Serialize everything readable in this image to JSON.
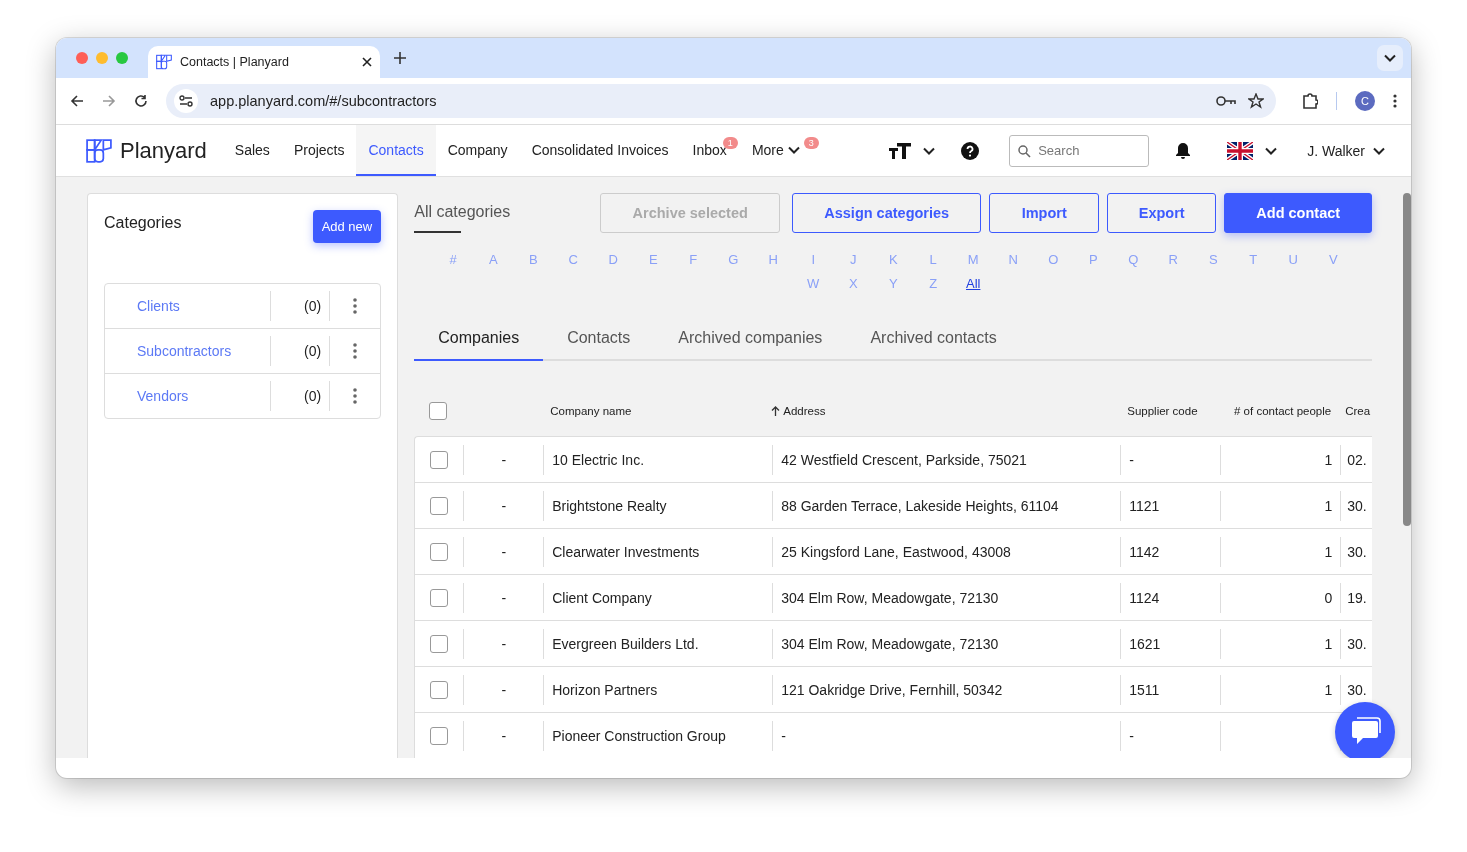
{
  "browser": {
    "tab_title": "Contacts | Planyard",
    "url": "app.planyard.com/#/subcontractors",
    "profile_initial": "C"
  },
  "app": {
    "logo": "Planyard",
    "nav": [
      {
        "label": "Sales",
        "selected": false
      },
      {
        "label": "Projects",
        "selected": false
      },
      {
        "label": "Contacts",
        "selected": true
      },
      {
        "label": "Company",
        "selected": false
      },
      {
        "label": "Consolidated Invoices",
        "selected": false
      },
      {
        "label": "Inbox",
        "selected": false,
        "badge": "1"
      },
      {
        "label": "More",
        "selected": false,
        "badge": "3",
        "kind": "menu"
      }
    ],
    "search": {
      "placeholder": "Search"
    },
    "user": "J. Walker"
  },
  "categories": {
    "title": "Categories",
    "add_button": "Add new",
    "items": [
      {
        "name": "Clients",
        "count": "(0)"
      },
      {
        "name": "Subcontractors",
        "count": "(0)"
      },
      {
        "name": "Vendors",
        "count": "(0)"
      }
    ]
  },
  "filter_label": "All categories",
  "actions": [
    {
      "label": "Archive selected",
      "kind": "disabled"
    },
    {
      "label": "Assign categories",
      "kind": "outline"
    },
    {
      "label": "Import",
      "kind": "outline"
    },
    {
      "label": "Export",
      "kind": "outline"
    },
    {
      "label": "Add contact",
      "kind": "primary"
    }
  ],
  "letters": [
    {
      "label": "#",
      "selected": false
    },
    {
      "label": "A",
      "selected": false
    },
    {
      "label": "B",
      "selected": false
    },
    {
      "label": "C",
      "selected": false
    },
    {
      "label": "D",
      "selected": false
    },
    {
      "label": "E",
      "selected": false
    },
    {
      "label": "F",
      "selected": false
    },
    {
      "label": "G",
      "selected": false
    },
    {
      "label": "H",
      "selected": false
    },
    {
      "label": "I",
      "selected": false
    },
    {
      "label": "J",
      "selected": false
    },
    {
      "label": "K",
      "selected": false
    },
    {
      "label": "L",
      "selected": false
    },
    {
      "label": "M",
      "selected": false
    },
    {
      "label": "N",
      "selected": false
    },
    {
      "label": "O",
      "selected": false
    },
    {
      "label": "P",
      "selected": false
    },
    {
      "label": "Q",
      "selected": false
    },
    {
      "label": "R",
      "selected": false
    },
    {
      "label": "S",
      "selected": false
    },
    {
      "label": "T",
      "selected": false
    },
    {
      "label": "U",
      "selected": false
    },
    {
      "label": "V",
      "selected": false
    },
    {
      "label": "W",
      "selected": false
    },
    {
      "label": "X",
      "selected": false
    },
    {
      "label": "Y",
      "selected": false
    },
    {
      "label": "Z",
      "selected": false
    },
    {
      "label": "All",
      "selected": true
    }
  ],
  "tabs": [
    {
      "label": "Companies",
      "selected": true
    },
    {
      "label": "Contacts",
      "selected": false
    },
    {
      "label": "Archived companies",
      "selected": false
    },
    {
      "label": "Archived contacts",
      "selected": false
    }
  ],
  "table": {
    "header_checked": false,
    "columns": [
      {
        "label": "Company name",
        "sorted": false
      },
      {
        "label": "Address",
        "sorted": true
      },
      {
        "label": "Supplier code",
        "sorted": false
      },
      {
        "label": "# of contact people",
        "sorted": false
      },
      {
        "label": "Crea",
        "sorted": false
      }
    ],
    "rows": [
      {
        "checked": false,
        "category": "-",
        "name": "10 Electric Inc.",
        "address": "42 Westfield Crescent, Parkside, 75021",
        "supplier_code": "-",
        "contacts": "1",
        "created": "02."
      },
      {
        "checked": false,
        "category": "-",
        "name": "Brightstone Realty",
        "address": "88 Garden Terrace, Lakeside Heights, 61104",
        "supplier_code": "1121",
        "contacts": "1",
        "created": "30."
      },
      {
        "checked": false,
        "category": "-",
        "name": "Clearwater Investments",
        "address": "25 Kingsford Lane, Eastwood, 43008",
        "supplier_code": "1142",
        "contacts": "1",
        "created": "30."
      },
      {
        "checked": false,
        "category": "-",
        "name": "Client Company",
        "address": "304 Elm Row, Meadowgate, 72130",
        "supplier_code": "1124",
        "contacts": "0",
        "created": "19."
      },
      {
        "checked": false,
        "category": "-",
        "name": "Evergreen Builders Ltd.",
        "address": "304 Elm Row, Meadowgate, 72130",
        "supplier_code": "1621",
        "contacts": "1",
        "created": "30."
      },
      {
        "checked": false,
        "category": "-",
        "name": "Horizon Partners",
        "address": "121 Oakridge Drive, Fernhill, 50342",
        "supplier_code": "1511",
        "contacts": "1",
        "created": "30."
      },
      {
        "checked": false,
        "category": "-",
        "name": "Pioneer Construction Group",
        "address": "-",
        "supplier_code": "-"
      }
    ]
  }
}
